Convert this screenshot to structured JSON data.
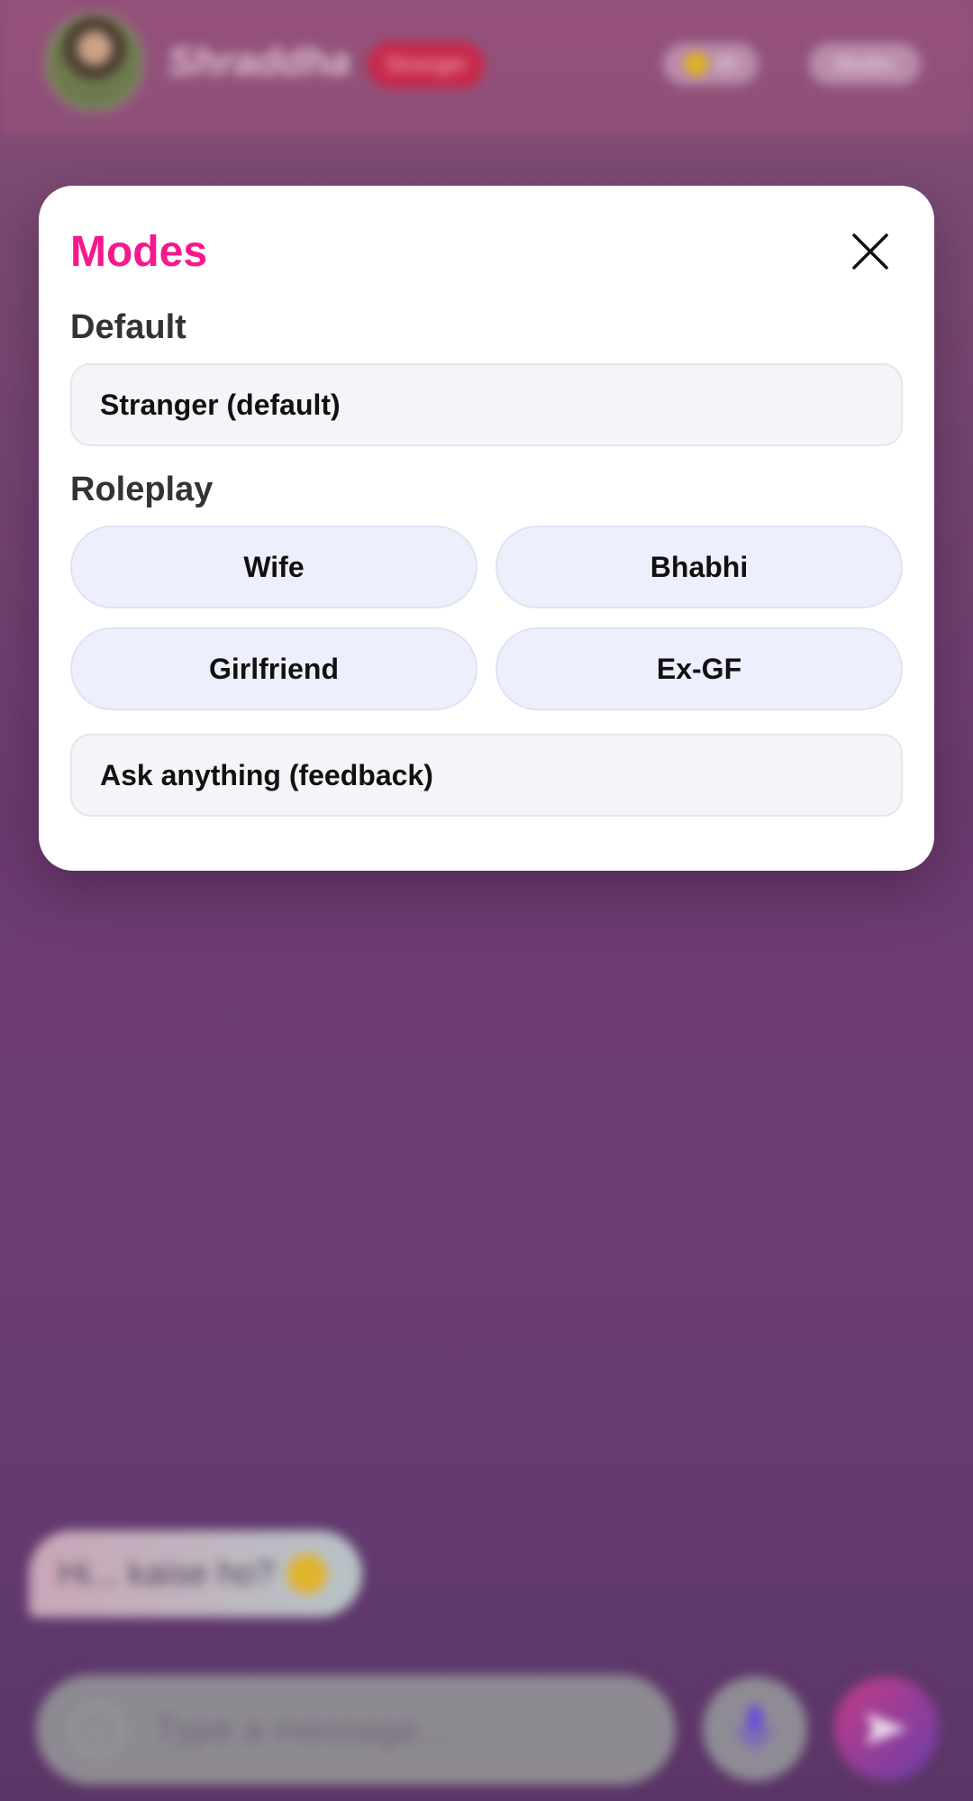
{
  "background": {
    "character_name": "Shraddha",
    "mode_badge": "Stranger",
    "coins_value": "90",
    "modes_button_label": "Modes",
    "chat_message": "Hi... kaise ho?",
    "composer_placeholder": "Type a message..."
  },
  "modal": {
    "title": "Modes",
    "default_heading": "Default",
    "default_option": "Stranger (default)",
    "roleplay_heading": "Roleplay",
    "roleplay_options": [
      "Wife",
      "Bhabhi",
      "Girlfriend",
      "Ex-GF"
    ],
    "feedback_option": "Ask anything (feedback)"
  },
  "colors": {
    "title_accent": "#f5198c",
    "modal_bg": "#ffffff",
    "role_button_bg": "#eeeffc",
    "wide_option_bg": "#f5f4f8"
  },
  "icons": {
    "close": "close-icon",
    "coin": "coin-icon",
    "smile": "smile-icon",
    "mic": "microphone-icon",
    "send": "send-icon"
  }
}
